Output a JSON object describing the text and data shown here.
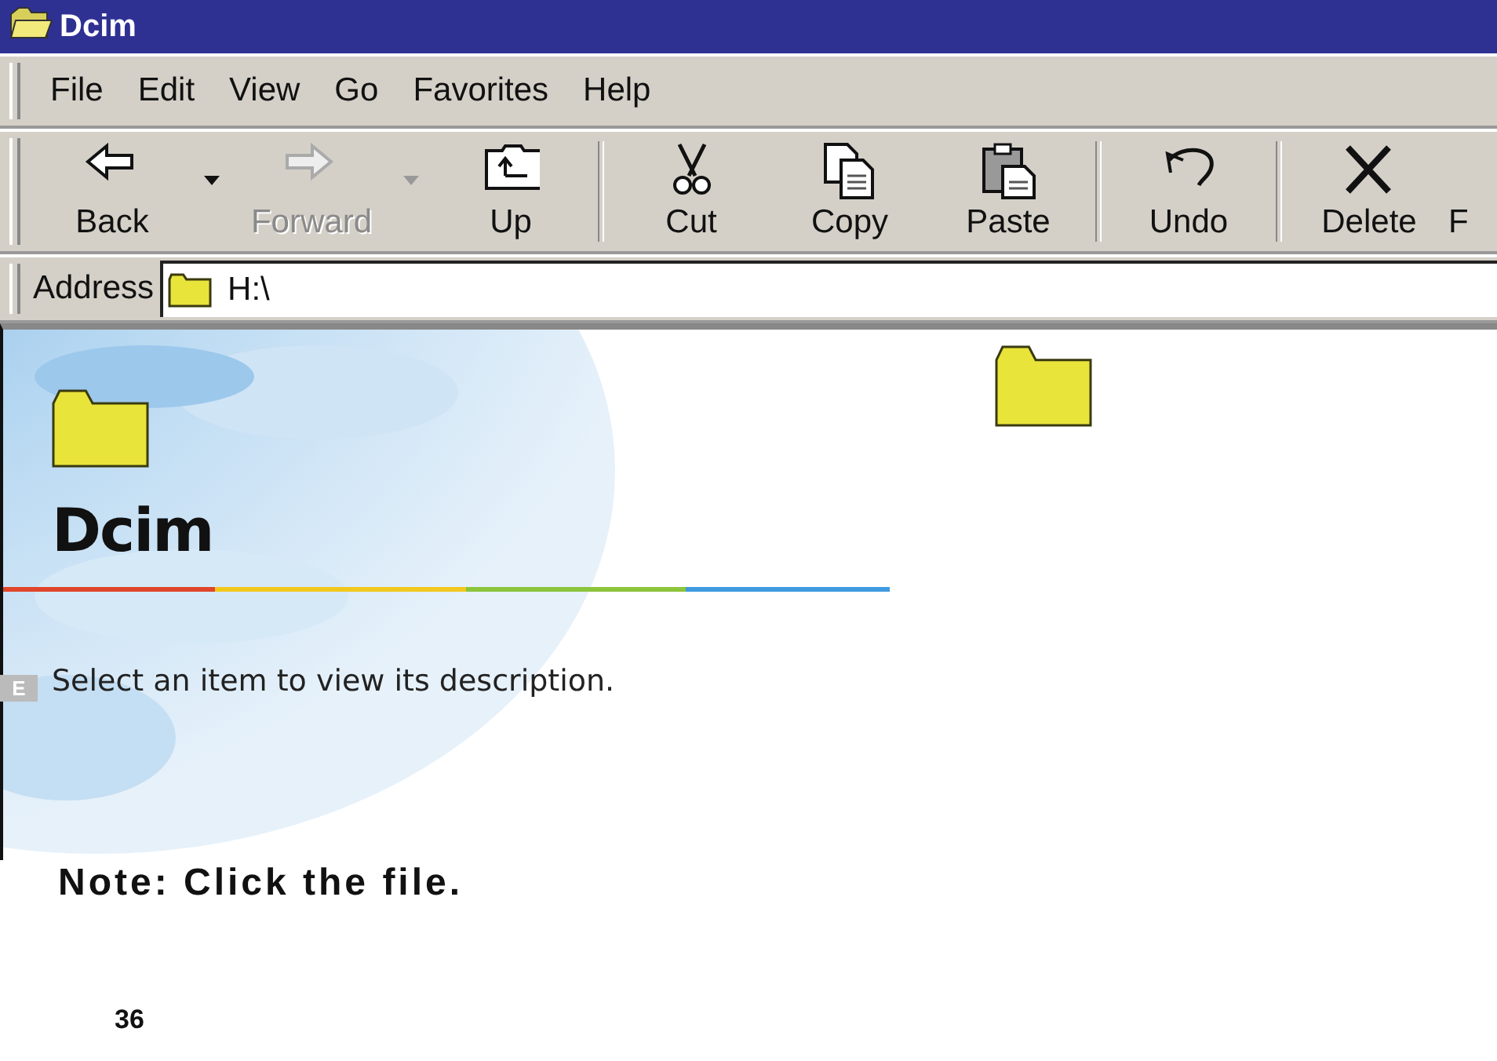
{
  "window": {
    "title": "Dcim"
  },
  "menu": [
    {
      "label": "File"
    },
    {
      "label": "Edit"
    },
    {
      "label": "View"
    },
    {
      "label": "Go"
    },
    {
      "label": "Favorites"
    },
    {
      "label": "Help"
    }
  ],
  "toolbar": [
    {
      "label": "Back",
      "kind": "back",
      "disabled": false,
      "dropdown": true,
      "separator_after": false
    },
    {
      "label": "Forward",
      "kind": "forward",
      "disabled": true,
      "dropdown": true,
      "separator_after": false
    },
    {
      "label": "Up",
      "kind": "up",
      "disabled": false,
      "dropdown": false,
      "separator_after": true
    },
    {
      "label": "Cut",
      "kind": "cut",
      "disabled": false,
      "dropdown": false,
      "separator_after": false
    },
    {
      "label": "Copy",
      "kind": "copy",
      "disabled": false,
      "dropdown": false,
      "separator_after": false
    },
    {
      "label": "Paste",
      "kind": "paste",
      "disabled": false,
      "dropdown": false,
      "separator_after": true
    },
    {
      "label": "Undo",
      "kind": "undo",
      "disabled": false,
      "dropdown": false,
      "separator_after": true
    },
    {
      "label": "Delete",
      "kind": "delete",
      "disabled": false,
      "dropdown": false,
      "separator_after": false
    },
    {
      "label": "F",
      "kind": "cutoff",
      "disabled": false,
      "dropdown": false,
      "separator_after": false
    }
  ],
  "address": {
    "label": "Address",
    "value": "H:\\"
  },
  "content": {
    "heading": "Dcim",
    "description": "Select an item to view its description."
  },
  "page": {
    "tab": "E",
    "note": "Note: Click the file.",
    "number": "36"
  }
}
